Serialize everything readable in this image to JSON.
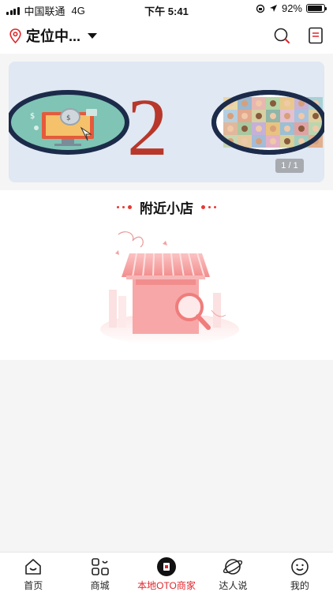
{
  "status_bar": {
    "carrier": "中国联通",
    "network": "4G",
    "time": "下午 5:41",
    "battery_percent": "92%",
    "battery_level": 0.92
  },
  "header": {
    "location_label": "定位中...",
    "icons": [
      "location-pin-icon",
      "search-icon",
      "list-icon"
    ]
  },
  "banner": {
    "text": "O2O",
    "pager": "1 / 1"
  },
  "section": {
    "title": "附近小店"
  },
  "tabbar": {
    "items": [
      {
        "label": "首页",
        "icon": "home-icon"
      },
      {
        "label": "商城",
        "icon": "mall-icon"
      },
      {
        "label": "本地OTO商家",
        "icon": "local-merchant-icon",
        "active": true
      },
      {
        "label": "达人说",
        "icon": "planet-icon"
      },
      {
        "label": "我的",
        "icon": "face-icon"
      }
    ]
  },
  "colors": {
    "accent": "#e0252b",
    "banner_bg": "#dfe8f3",
    "o2o_red": "#b8372a",
    "circle_border": "#1c2b4a"
  }
}
